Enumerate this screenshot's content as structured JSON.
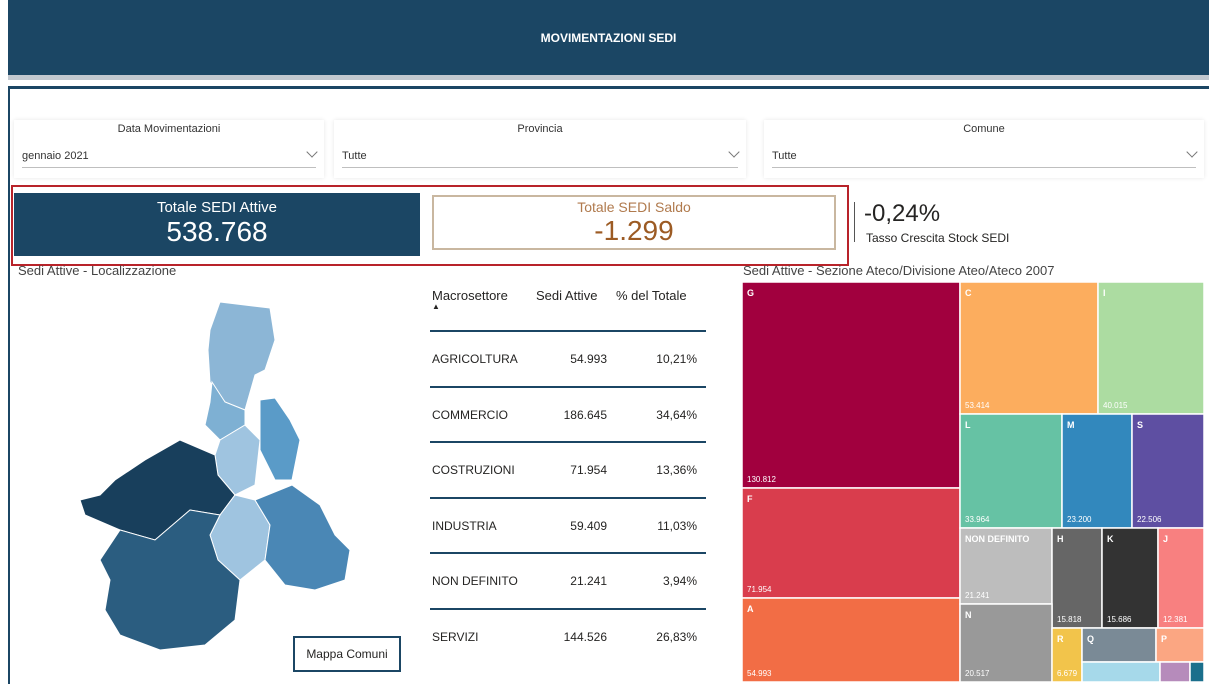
{
  "header": {
    "title": "MOVIMENTAZIONI SEDI"
  },
  "slicers": {
    "data": {
      "title": "Data Movimentazioni",
      "value": "gennaio 2021"
    },
    "provincia": {
      "title": "Provincia",
      "value": "Tutte"
    },
    "comune": {
      "title": "Comune",
      "value": "Tutte"
    }
  },
  "cards": {
    "attive": {
      "title": "Totale SEDI Attive",
      "value": "538.768"
    },
    "saldo": {
      "title": "Totale SEDI Saldo",
      "value": "-1.299"
    },
    "tasso": {
      "value": "-0,24%",
      "label": "Tasso Crescita Stock SEDI"
    }
  },
  "map": {
    "title": "Sedi Attive - Localizzazione",
    "button_label": "Mappa Comuni"
  },
  "table": {
    "headers": [
      "Macrosettore",
      "Sedi Attive",
      "% del Totale"
    ],
    "sort_indicator": "▲",
    "rows": [
      {
        "macrosettore": "AGRICOLTURA",
        "sedi": "54.993",
        "perc": "10,21%"
      },
      {
        "macrosettore": "COMMERCIO",
        "sedi": "186.645",
        "perc": "34,64%"
      },
      {
        "macrosettore": "COSTRUZIONI",
        "sedi": "71.954",
        "perc": "13,36%"
      },
      {
        "macrosettore": "INDUSTRIA",
        "sedi": "59.409",
        "perc": "11,03%"
      },
      {
        "macrosettore": "NON DEFINITO",
        "sedi": "21.241",
        "perc": "3,94%"
      },
      {
        "macrosettore": "SERVIZI",
        "sedi": "144.526",
        "perc": "26,83%"
      }
    ]
  },
  "treemap": {
    "title": "Sedi Attive - Sezione Ateco/Divisione Ateo/Ateco 2007",
    "colors": {
      "G": "#a1003e",
      "F": "#d93d4d",
      "A": "#f26d45",
      "C": "#fcad5e",
      "I": "#acdca1",
      "L": "#66c2a4",
      "M": "#3288bd",
      "S": "#5e4fa2",
      "NON DEFINITO": "#bdbdbd",
      "H": "#666666",
      "K": "#333333",
      "J": "#f88080",
      "N": "#999999",
      "R": "#f2c44b",
      "Q": "#7a8a96",
      "P": "#fba682",
      "E": "#a6d9ea",
      "B": "#b68bbb",
      "D": "#1a6f8c"
    }
  },
  "chart_data": {
    "type": "treemap",
    "title": "Sedi Attive - Sezione Ateco/Divisione Ateo/Ateco 2007",
    "nodes": [
      {
        "label": "G",
        "value": 130812,
        "value_label": "130.812"
      },
      {
        "label": "F",
        "value": 71954,
        "value_label": "71.954"
      },
      {
        "label": "A",
        "value": 54993,
        "value_label": "54.993"
      },
      {
        "label": "C",
        "value": 53414,
        "value_label": "53.414"
      },
      {
        "label": "I",
        "value": 40015,
        "value_label": "40.015"
      },
      {
        "label": "L",
        "value": 33964,
        "value_label": "33.964"
      },
      {
        "label": "M",
        "value": 23200,
        "value_label": "23.200"
      },
      {
        "label": "S",
        "value": 22506,
        "value_label": "22.506"
      },
      {
        "label": "NON DEFINITO",
        "value": 21241,
        "value_label": "21.241"
      },
      {
        "label": "H",
        "value": 15818,
        "value_label": "15.818"
      },
      {
        "label": "K",
        "value": 15686,
        "value_label": "15.686"
      },
      {
        "label": "J",
        "value": 12381,
        "value_label": "12.381"
      },
      {
        "label": "N",
        "value": 20517,
        "value_label": "20.517"
      },
      {
        "label": "R",
        "value": 6679,
        "value_label": "6.679"
      },
      {
        "label": "Q",
        "value": null,
        "value_label": ""
      },
      {
        "label": "P",
        "value": null,
        "value_label": ""
      }
    ]
  }
}
